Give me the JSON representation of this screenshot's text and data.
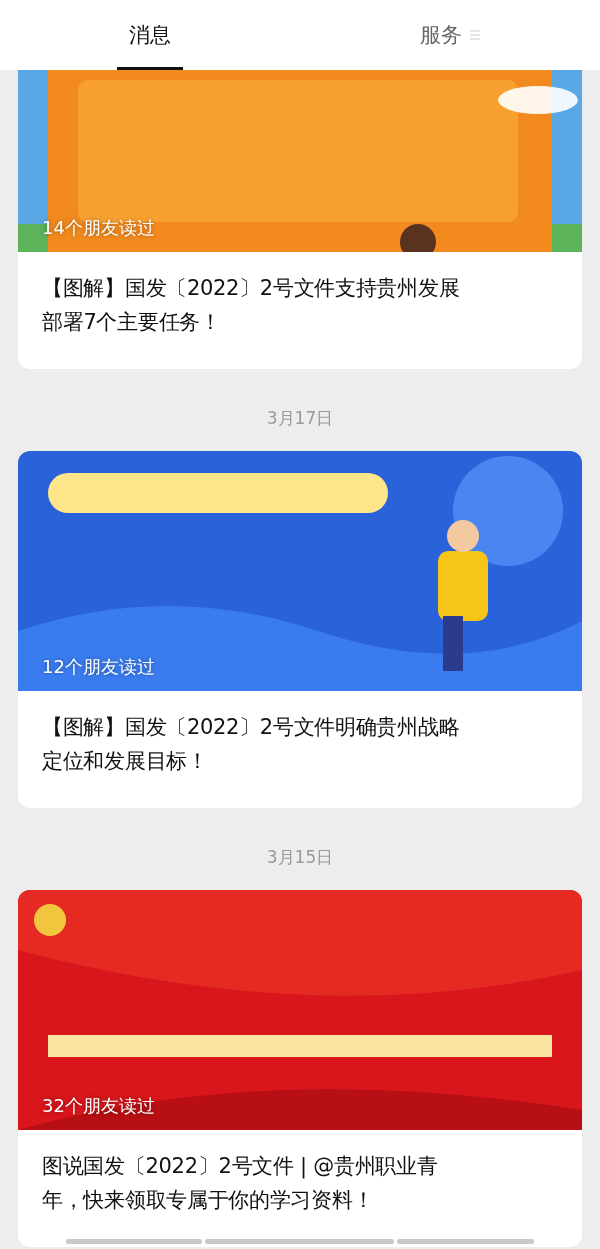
{
  "tabs": [
    {
      "label": "消息",
      "selected": true,
      "menu": false
    },
    {
      "label": "服务",
      "selected": false,
      "menu": true
    }
  ],
  "feed": [
    {
      "kind": "article",
      "cut_top": true,
      "readers": "14个朋友读过",
      "title_lines": [
        "【图解】国发〔2022〕2号文件支持贵州发展",
        "部署7个主要任务！"
      ],
      "stacked": false
    },
    {
      "kind": "date",
      "text": "3月17日"
    },
    {
      "kind": "article",
      "cut_top": false,
      "readers": "12个朋友读过",
      "title_lines": [
        "【图解】国发〔2022〕2号文件明确贵州战略",
        "定位和发展目标！"
      ],
      "stacked": false
    },
    {
      "kind": "date",
      "text": "3月15日"
    },
    {
      "kind": "article",
      "cut_top": false,
      "readers": "32个朋友读过",
      "title_lines": [
        "图说国发〔2022〕2号文件 | @贵州职业青",
        "年，快来领取专属于你的学习资料！"
      ],
      "stacked": true
    }
  ]
}
